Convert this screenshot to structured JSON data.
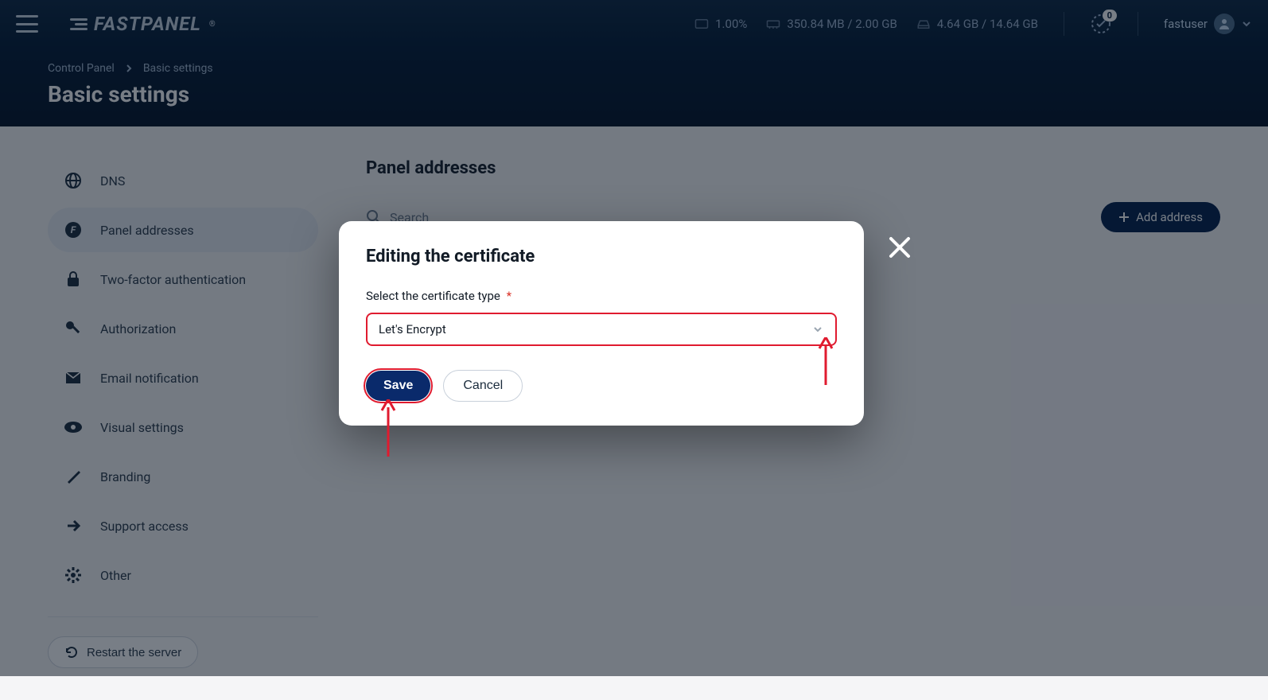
{
  "logo_text": "FASTPANEL",
  "logo_reg": "®",
  "stats": {
    "cpu": "1.00%",
    "ram": "350.84 MB / 2.00 GB",
    "disk": "4.64 GB / 14.64 GB"
  },
  "notif_count": "0",
  "username": "fastuser",
  "breadcrumb": {
    "root": "Control Panel",
    "current": "Basic settings"
  },
  "page_title": "Basic settings",
  "sidebar": {
    "items": [
      {
        "label": "DNS"
      },
      {
        "label": "Panel addresses"
      },
      {
        "label": "Two-factor authentication"
      },
      {
        "label": "Authorization"
      },
      {
        "label": "Email notification"
      },
      {
        "label": "Visual settings"
      },
      {
        "label": "Branding"
      },
      {
        "label": "Support access"
      },
      {
        "label": "Other"
      }
    ],
    "restart_label": "Restart the server"
  },
  "content": {
    "title": "Panel addresses",
    "search_placeholder": "Search",
    "add_button": "Add address"
  },
  "modal": {
    "title": "Editing the certificate",
    "field_label": "Select the certificate type",
    "required_marker": "*",
    "selected_value": "Let's Encrypt",
    "save_label": "Save",
    "cancel_label": "Cancel"
  }
}
